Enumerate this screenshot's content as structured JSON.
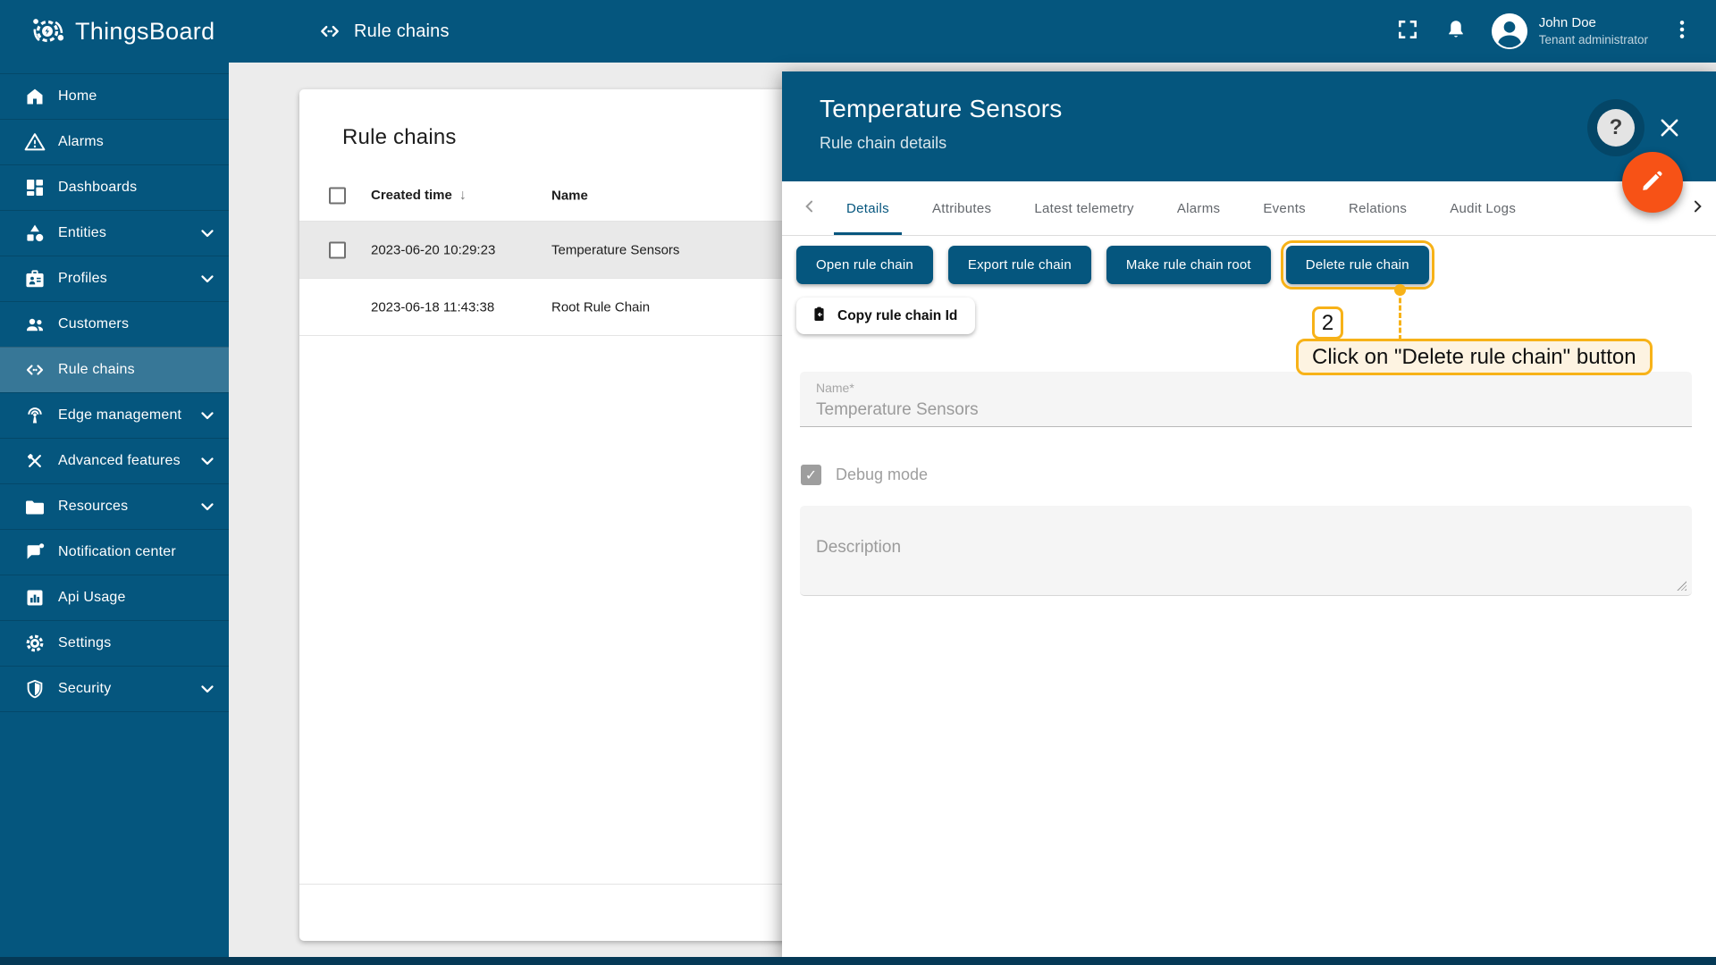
{
  "colors": {
    "primary": "#05567e",
    "fab_orange": "#f75216",
    "annotation_gold": "#f7b218",
    "annotation_fill": "#fdf3e1",
    "page_bg": "#ececec",
    "selected_row": "#e9e9e9",
    "bottom_strip": "#053956"
  },
  "brand": {
    "name": "ThingsBoard"
  },
  "toolbar": {
    "title": "Rule chains",
    "user": {
      "name": "John Doe",
      "role": "Tenant administrator"
    }
  },
  "sidebar": {
    "items": [
      {
        "id": "home",
        "label": "Home",
        "icon": "home",
        "expandable": false,
        "selected": false
      },
      {
        "id": "alarms",
        "label": "Alarms",
        "icon": "alarms",
        "expandable": false,
        "selected": false
      },
      {
        "id": "dashboards",
        "label": "Dashboards",
        "icon": "dashboards",
        "expandable": false,
        "selected": false
      },
      {
        "id": "entities",
        "label": "Entities",
        "icon": "entities",
        "expandable": true,
        "selected": false
      },
      {
        "id": "profiles",
        "label": "Profiles",
        "icon": "profiles",
        "expandable": true,
        "selected": false
      },
      {
        "id": "customers",
        "label": "Customers",
        "icon": "customers",
        "expandable": false,
        "selected": false
      },
      {
        "id": "rule-chains",
        "label": "Rule chains",
        "icon": "rule-chains",
        "expandable": false,
        "selected": true
      },
      {
        "id": "edge-management",
        "label": "Edge management",
        "icon": "edge-management",
        "expandable": true,
        "selected": false
      },
      {
        "id": "advanced-features",
        "label": "Advanced features",
        "icon": "advanced-features",
        "expandable": true,
        "selected": false
      },
      {
        "id": "resources",
        "label": "Resources",
        "icon": "resources",
        "expandable": true,
        "selected": false
      },
      {
        "id": "notification-center",
        "label": "Notification center",
        "icon": "notification-center",
        "expandable": false,
        "selected": false
      },
      {
        "id": "api-usage",
        "label": "Api Usage",
        "icon": "api-usage",
        "expandable": false,
        "selected": false
      },
      {
        "id": "settings",
        "label": "Settings",
        "icon": "settings",
        "expandable": false,
        "selected": false
      },
      {
        "id": "security",
        "label": "Security",
        "icon": "security",
        "expandable": true,
        "selected": false
      }
    ]
  },
  "table": {
    "title": "Rule chains",
    "columns": [
      "Created time",
      "Name"
    ],
    "sort": {
      "column": "Created time",
      "direction": "desc",
      "indicator": "↓"
    },
    "rows": [
      {
        "created_time": "2023-06-20 10:29:23",
        "name": "Temperature Sensors",
        "selected": true,
        "has_checkbox": true
      },
      {
        "created_time": "2023-06-18 11:43:38",
        "name": "Root Rule Chain",
        "selected": false,
        "has_checkbox": false
      }
    ]
  },
  "panel": {
    "title": "Temperature Sensors",
    "subtitle": "Rule chain details",
    "active_tab": "Details",
    "tabs": [
      "Details",
      "Attributes",
      "Latest telemetry",
      "Alarms",
      "Events",
      "Relations",
      "Audit Logs"
    ],
    "actions": [
      {
        "label": "Open rule chain",
        "highlighted": false
      },
      {
        "label": "Export rule chain",
        "highlighted": false
      },
      {
        "label": "Make rule chain root",
        "highlighted": false
      },
      {
        "label": "Delete rule chain",
        "highlighted": true
      }
    ],
    "copy_button_label": "Copy rule chain Id",
    "form": {
      "name_label": "Name*",
      "name_value": "Temperature Sensors",
      "debug_label": "Debug mode",
      "debug_checked": true,
      "debug_check_glyph": "✓",
      "description_placeholder": "Description"
    }
  },
  "annotation": {
    "step": "2",
    "label": "Click on \"Delete rule chain\" button",
    "target": "Delete rule chain"
  }
}
